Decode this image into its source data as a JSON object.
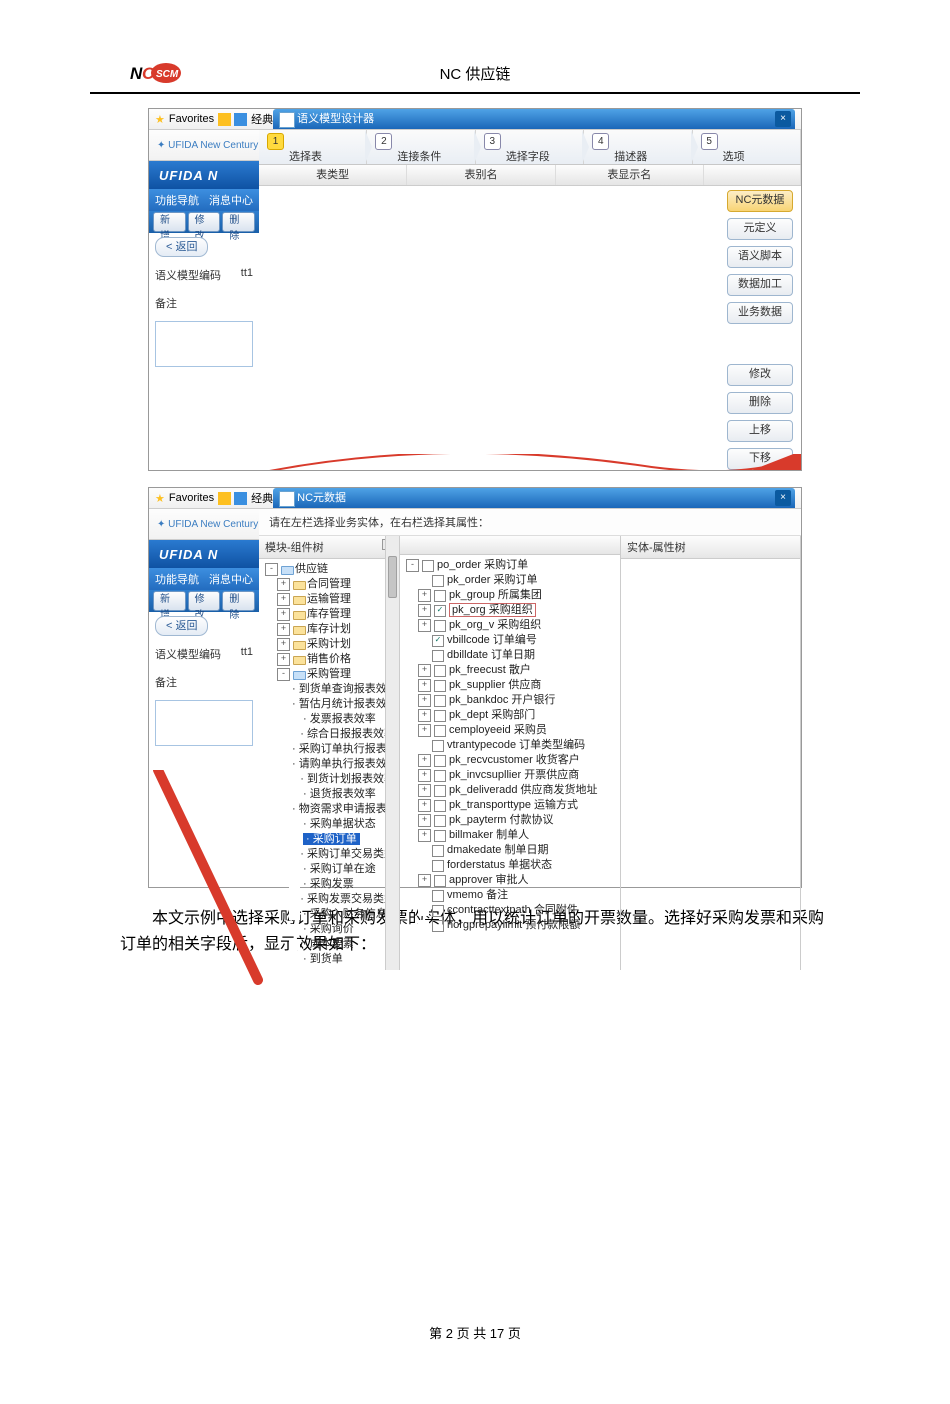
{
  "header": {
    "title": "NC 供应链"
  },
  "favorites": {
    "label": "Favorites",
    "tail": "经典",
    "product": "UFIDA New Century",
    "brand": "UFIDA N"
  },
  "screenshot1": {
    "winTitle": "语义模型设计器",
    "steps": [
      {
        "num": "1",
        "label": "选择表"
      },
      {
        "num": "2",
        "label": "连接条件"
      },
      {
        "num": "3",
        "label": "选择字段"
      },
      {
        "num": "4",
        "label": "描述器"
      },
      {
        "num": "5",
        "label": "选项"
      }
    ],
    "tableHeads": [
      "表类型",
      "表别名",
      "表显示名"
    ],
    "nav": {
      "func": "功能导航",
      "msg": "消息中心",
      "add": "新增",
      "edit": "修改",
      "del": "删除"
    },
    "back": "< 返回",
    "row1a": "语义模型编码",
    "row1b": "tt1",
    "row2": "备注",
    "rightBtns": [
      "NC元数据",
      "元定义",
      "语义脚本",
      "数据加工",
      "业务数据"
    ],
    "rightBtns2": [
      "修改",
      "删除",
      "上移",
      "下移"
    ]
  },
  "screenshot2": {
    "winTitle": "NC元数据",
    "hint": "请在左栏选择业务实体，在右栏选择其属性：",
    "leftHead": "模块-组件树",
    "rightHead": "实体-属性树",
    "leftTree": [
      {
        "d": 0,
        "t": "-",
        "f": "open",
        "x": "供应链"
      },
      {
        "d": 1,
        "t": "+",
        "f": "closed",
        "x": "合同管理"
      },
      {
        "d": 1,
        "t": "+",
        "f": "closed",
        "x": "运输管理"
      },
      {
        "d": 1,
        "t": "+",
        "f": "closed",
        "x": "库存管理"
      },
      {
        "d": 1,
        "t": "+",
        "f": "closed",
        "x": "库存计划"
      },
      {
        "d": 1,
        "t": "+",
        "f": "closed",
        "x": "采购计划"
      },
      {
        "d": 1,
        "t": "+",
        "f": "closed",
        "x": "销售价格"
      },
      {
        "d": 1,
        "t": "-",
        "f": "open",
        "x": "采购管理"
      },
      {
        "d": 2,
        "t": "",
        "x": "· 到货单查询报表效率"
      },
      {
        "d": 2,
        "t": "",
        "x": "· 暂估月统计报表效率"
      },
      {
        "d": 2,
        "t": "",
        "x": "· 发票报表效率"
      },
      {
        "d": 2,
        "t": "",
        "x": "· 综合日报报表效率"
      },
      {
        "d": 2,
        "t": "",
        "x": "· 采购订单执行报表效率"
      },
      {
        "d": 2,
        "t": "",
        "x": "· 请购单执行报表效率"
      },
      {
        "d": 2,
        "t": "",
        "x": "· 到货计划报表效率"
      },
      {
        "d": 2,
        "t": "",
        "x": "· 退货报表效率"
      },
      {
        "d": 2,
        "t": "",
        "x": "· 物资需求申请报表效率"
      },
      {
        "d": 2,
        "t": "",
        "x": "· 采购单据状态"
      },
      {
        "d": 2,
        "t": "",
        "x": "· 采购订单",
        "sel": true
      },
      {
        "d": 2,
        "t": "",
        "x": "· 采购订单交易类型"
      },
      {
        "d": 2,
        "t": "",
        "x": "· 采购订单在途"
      },
      {
        "d": 2,
        "t": "",
        "x": "· 采购发票"
      },
      {
        "d": 2,
        "t": "",
        "x": "· 采购发票交易类型"
      },
      {
        "d": 2,
        "t": "",
        "x": "· 采购入财务信息"
      },
      {
        "d": 2,
        "t": "",
        "x": "· 采购询价"
      },
      {
        "d": 2,
        "t": "",
        "x": "· 成本要素"
      },
      {
        "d": 2,
        "t": "",
        "x": "· 到货单"
      }
    ],
    "rightTree": [
      {
        "d": 0,
        "t": "-",
        "c": "",
        "x": "po_order 采购订单"
      },
      {
        "d": 1,
        "t": "",
        "c": "",
        "x": "pk_order 采购订单"
      },
      {
        "d": 1,
        "t": "+",
        "c": "",
        "x": "pk_group 所属集团"
      },
      {
        "d": 1,
        "t": "+",
        "c": "v",
        "x": "pk_org 采购组织",
        "hl": true
      },
      {
        "d": 1,
        "t": "+",
        "c": "",
        "x": "pk_org_v 采购组织"
      },
      {
        "d": 1,
        "t": "",
        "c": "v",
        "x": "vbillcode 订单编号"
      },
      {
        "d": 1,
        "t": "",
        "c": "",
        "x": "dbilldate 订单日期"
      },
      {
        "d": 1,
        "t": "+",
        "c": "",
        "x": "pk_freecust 散户"
      },
      {
        "d": 1,
        "t": "+",
        "c": "",
        "x": "pk_supplier 供应商"
      },
      {
        "d": 1,
        "t": "+",
        "c": "",
        "x": "pk_bankdoc 开户银行"
      },
      {
        "d": 1,
        "t": "+",
        "c": "",
        "x": "pk_dept 采购部门"
      },
      {
        "d": 1,
        "t": "+",
        "c": "",
        "x": "cemployeeid 采购员"
      },
      {
        "d": 1,
        "t": "",
        "c": "",
        "x": "vtrantypecode 订单类型编码"
      },
      {
        "d": 1,
        "t": "+",
        "c": "",
        "x": "pk_recvcustomer 收货客户"
      },
      {
        "d": 1,
        "t": "+",
        "c": "",
        "x": "pk_invcsupllier 开票供应商"
      },
      {
        "d": 1,
        "t": "+",
        "c": "",
        "x": "pk_deliveradd 供应商发货地址"
      },
      {
        "d": 1,
        "t": "+",
        "c": "",
        "x": "pk_transporttype 运输方式"
      },
      {
        "d": 1,
        "t": "+",
        "c": "",
        "x": "pk_payterm 付款协议"
      },
      {
        "d": 1,
        "t": "+",
        "c": "",
        "x": "billmaker 制单人"
      },
      {
        "d": 1,
        "t": "",
        "c": "",
        "x": "dmakedate 制单日期"
      },
      {
        "d": 1,
        "t": "",
        "c": "",
        "x": "forderstatus 单据状态"
      },
      {
        "d": 1,
        "t": "+",
        "c": "",
        "x": "approver 审批人"
      },
      {
        "d": 1,
        "t": "",
        "c": "",
        "x": "vmemo 备注"
      },
      {
        "d": 1,
        "t": "",
        "c": "",
        "x": "ccontracttextpath 合同附件"
      },
      {
        "d": 1,
        "t": "",
        "c": "",
        "x": "norgprepaylimit 预付款限额"
      }
    ]
  },
  "body": {
    "p1": "本文示例中选择采购订单和采购发票的实体，用以统计订单的开票数量。选择好采购发票和采购订单的相关字段后，显示效果如下："
  },
  "footer": {
    "text": "第 2 页 共 17 页"
  }
}
